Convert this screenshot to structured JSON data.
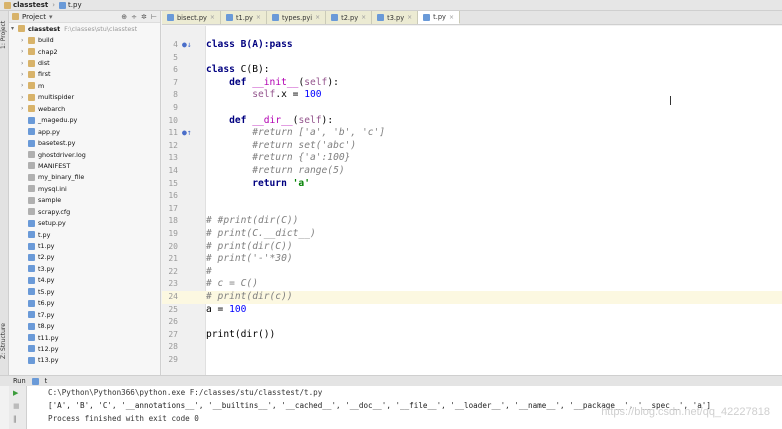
{
  "titlebar": {
    "project": "classtest",
    "file": "t.py"
  },
  "side_tabs": {
    "project_tab": "1: Project",
    "structure_tab": "Z: Structure"
  },
  "project_panel": {
    "title": "Project",
    "root_name": "classtest",
    "root_path": "F:\\classes\\stu\\classtest",
    "items": [
      {
        "name": "build",
        "kind": "folder"
      },
      {
        "name": "chap2",
        "kind": "folder"
      },
      {
        "name": "dist",
        "kind": "folder"
      },
      {
        "name": "first",
        "kind": "folder"
      },
      {
        "name": "m",
        "kind": "folder"
      },
      {
        "name": "multispider",
        "kind": "folder"
      },
      {
        "name": "webarch",
        "kind": "folder"
      },
      {
        "name": "_magedu.py",
        "kind": "py"
      },
      {
        "name": "app.py",
        "kind": "py"
      },
      {
        "name": "basetest.py",
        "kind": "py"
      },
      {
        "name": "ghostdriver.log",
        "kind": "file"
      },
      {
        "name": "MANIFEST",
        "kind": "file"
      },
      {
        "name": "my_binary_file",
        "kind": "file"
      },
      {
        "name": "mysql.ini",
        "kind": "file"
      },
      {
        "name": "sample",
        "kind": "file"
      },
      {
        "name": "scrapy.cfg",
        "kind": "file"
      },
      {
        "name": "setup.py",
        "kind": "py"
      },
      {
        "name": "t.py",
        "kind": "py"
      },
      {
        "name": "t1.py",
        "kind": "py"
      },
      {
        "name": "t2.py",
        "kind": "py"
      },
      {
        "name": "t3.py",
        "kind": "py"
      },
      {
        "name": "t4.py",
        "kind": "py"
      },
      {
        "name": "t5.py",
        "kind": "py"
      },
      {
        "name": "t6.py",
        "kind": "py"
      },
      {
        "name": "t7.py",
        "kind": "py"
      },
      {
        "name": "t8.py",
        "kind": "py"
      },
      {
        "name": "t11.py",
        "kind": "py"
      },
      {
        "name": "t12.py",
        "kind": "py"
      },
      {
        "name": "t13.py",
        "kind": "py"
      }
    ]
  },
  "tabs": [
    {
      "label": "bisect.py",
      "active": false
    },
    {
      "label": "t1.py",
      "active": false
    },
    {
      "label": "types.pyi",
      "active": false
    },
    {
      "label": "t2.py",
      "active": false
    },
    {
      "label": "t3.py",
      "active": false
    },
    {
      "label": "t.py",
      "active": true
    }
  ],
  "code_lines": [
    {
      "num": "4",
      "gutter": "●↓",
      "highlight": false,
      "tokens": [
        {
          "t": "class B(A):pass",
          "c": "kw"
        }
      ]
    },
    {
      "num": "5",
      "gutter": "",
      "highlight": false,
      "tokens": []
    },
    {
      "num": "6",
      "gutter": "",
      "highlight": false,
      "tokens": [
        {
          "t": "class ",
          "c": "kw"
        },
        {
          "t": "C(B):",
          "c": "fn"
        }
      ]
    },
    {
      "num": "7",
      "gutter": "",
      "highlight": false,
      "tokens": [
        {
          "t": "    def ",
          "c": "kw"
        },
        {
          "t": "__init__",
          "c": "magic"
        },
        {
          "t": "(",
          "c": "fn"
        },
        {
          "t": "self",
          "c": "self"
        },
        {
          "t": "):",
          "c": "fn"
        }
      ]
    },
    {
      "num": "8",
      "gutter": "",
      "highlight": false,
      "tokens": [
        {
          "t": "        ",
          "c": "fn"
        },
        {
          "t": "self",
          "c": "self"
        },
        {
          "t": ".x = ",
          "c": "fn"
        },
        {
          "t": "100",
          "c": "num"
        }
      ]
    },
    {
      "num": "9",
      "gutter": "",
      "highlight": false,
      "tokens": []
    },
    {
      "num": "10",
      "gutter": "",
      "highlight": false,
      "tokens": [
        {
          "t": "    def ",
          "c": "kw"
        },
        {
          "t": "__dir__",
          "c": "magic"
        },
        {
          "t": "(",
          "c": "fn"
        },
        {
          "t": "self",
          "c": "self"
        },
        {
          "t": "):",
          "c": "fn"
        }
      ]
    },
    {
      "num": "11",
      "gutter": "●↑",
      "highlight": false,
      "tokens": [
        {
          "t": "        #return ['a', 'b', 'c']",
          "c": "cm"
        }
      ]
    },
    {
      "num": "12",
      "gutter": "",
      "highlight": false,
      "tokens": [
        {
          "t": "        #return set('abc')",
          "c": "cm"
        }
      ]
    },
    {
      "num": "13",
      "gutter": "",
      "highlight": false,
      "tokens": [
        {
          "t": "        #return {'a':100}",
          "c": "cm"
        }
      ]
    },
    {
      "num": "14",
      "gutter": "",
      "highlight": false,
      "tokens": [
        {
          "t": "        #return range(5)",
          "c": "cm"
        }
      ]
    },
    {
      "num": "15",
      "gutter": "",
      "highlight": false,
      "tokens": [
        {
          "t": "        return ",
          "c": "kw"
        },
        {
          "t": "'a'",
          "c": "str"
        }
      ]
    },
    {
      "num": "16",
      "gutter": "",
      "highlight": false,
      "tokens": []
    },
    {
      "num": "17",
      "gutter": "",
      "highlight": false,
      "tokens": []
    },
    {
      "num": "18",
      "gutter": "",
      "highlight": false,
      "tokens": [
        {
          "t": "# #print(dir(C))",
          "c": "cm"
        }
      ]
    },
    {
      "num": "19",
      "gutter": "",
      "highlight": false,
      "tokens": [
        {
          "t": "# print(C.__dict__)",
          "c": "cm"
        }
      ]
    },
    {
      "num": "20",
      "gutter": "",
      "highlight": false,
      "tokens": [
        {
          "t": "# print(dir(C))",
          "c": "cm"
        }
      ]
    },
    {
      "num": "21",
      "gutter": "",
      "highlight": false,
      "tokens": [
        {
          "t": "# print('-'*30)",
          "c": "cm"
        }
      ]
    },
    {
      "num": "22",
      "gutter": "",
      "highlight": false,
      "tokens": [
        {
          "t": "#",
          "c": "cm"
        }
      ]
    },
    {
      "num": "23",
      "gutter": "",
      "highlight": false,
      "tokens": [
        {
          "t": "# c = C()",
          "c": "cm"
        }
      ]
    },
    {
      "num": "24",
      "gutter": "",
      "highlight": true,
      "tokens": [
        {
          "t": "# print(dir(c))",
          "c": "cm"
        }
      ]
    },
    {
      "num": "25",
      "gutter": "",
      "highlight": false,
      "tokens": [
        {
          "t": "a = ",
          "c": "fn"
        },
        {
          "t": "100",
          "c": "num"
        }
      ]
    },
    {
      "num": "26",
      "gutter": "",
      "highlight": false,
      "tokens": []
    },
    {
      "num": "27",
      "gutter": "",
      "highlight": false,
      "tokens": [
        {
          "t": "print(dir())",
          "c": "fn"
        }
      ]
    },
    {
      "num": "28",
      "gutter": "",
      "highlight": false,
      "tokens": []
    },
    {
      "num": "29",
      "gutter": "",
      "highlight": false,
      "tokens": []
    }
  ],
  "run": {
    "label": "Run",
    "config": "t",
    "command": "C:\\Python\\Python366\\python.exe F:/classes/stu/classtest/t.py",
    "output": "['A', 'B', 'C', '__annotations__', '__builtins__', '__cached__', '__doc__', '__file__', '__loader__', '__name__', '__package__', '__spec__', 'a']",
    "exit": "Process finished with exit code 0"
  },
  "watermark": "https://blog.csdn.net/qq_42227818",
  "icons": {
    "run": "play-icon",
    "stop": "stop-icon",
    "settings": "gear-icon"
  }
}
